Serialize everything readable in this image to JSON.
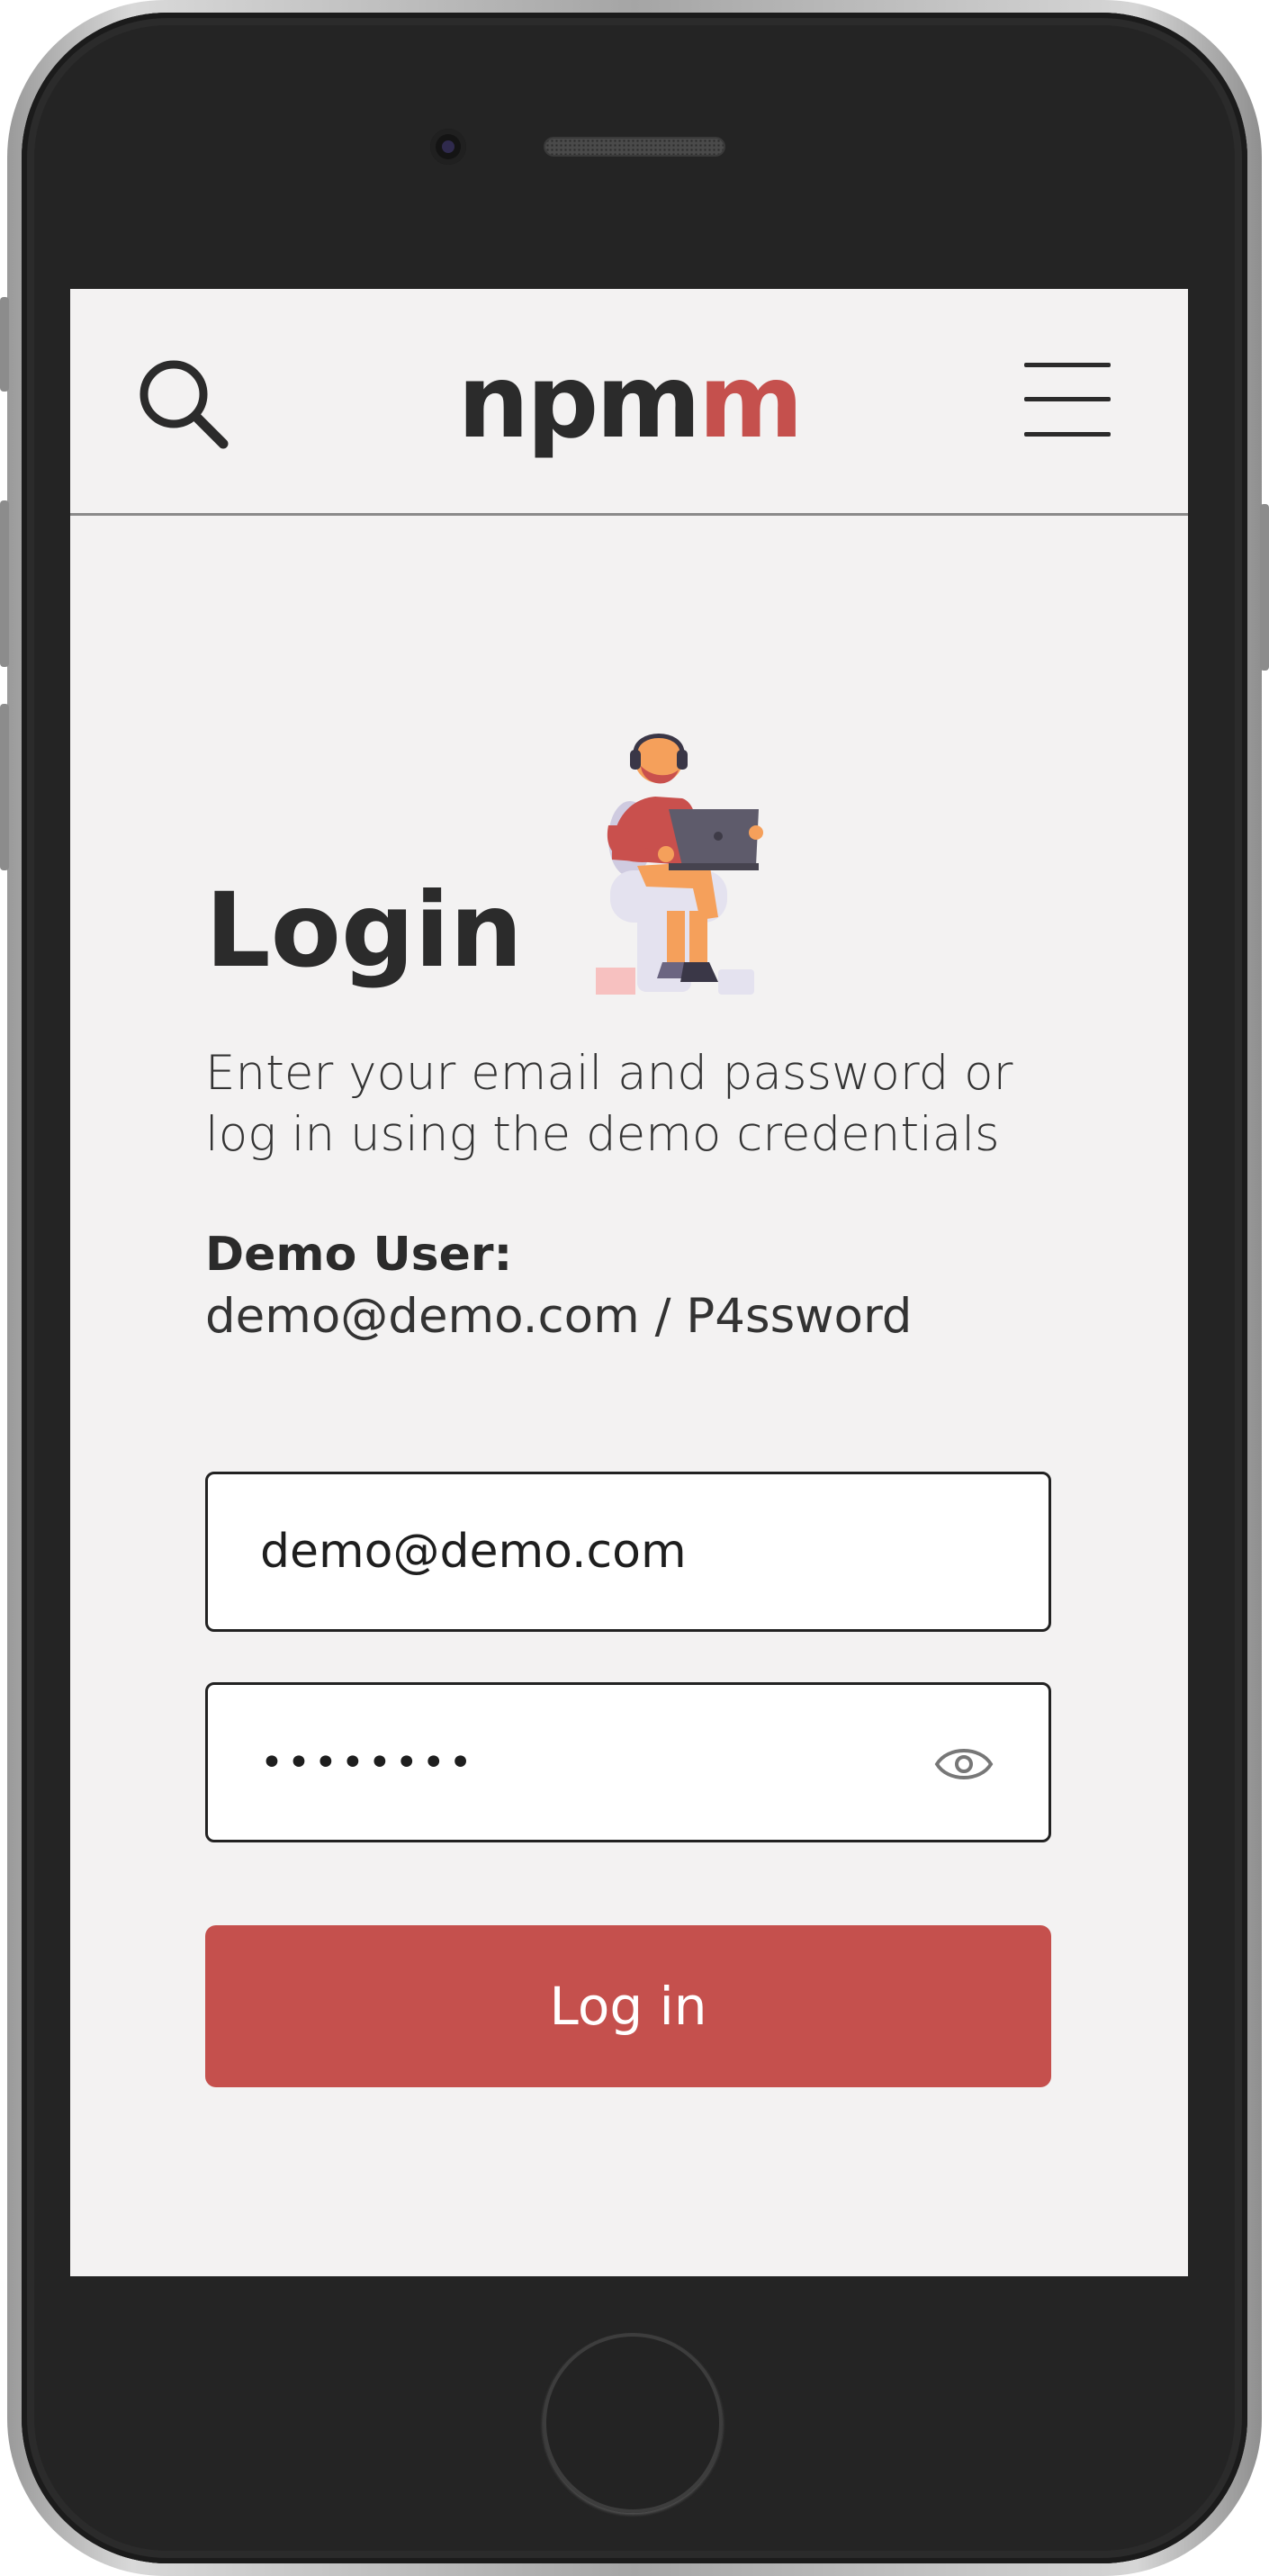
{
  "app": {
    "logo_main": "npm",
    "logo_accent": "m",
    "brand_color": "#c5504d"
  },
  "header": {
    "search_icon": "search-icon",
    "menu_icon": "hamburger-menu-icon"
  },
  "login": {
    "title": "Login",
    "subtitle": "Enter your email and password or log in using the demo credentials",
    "demo_label": "Demo User:",
    "demo_credentials": "demo@demo.com / P4ssword",
    "email_value": "demo@demo.com",
    "password_mask": "••••••••",
    "show_password_icon": "eye-icon",
    "submit_label": "Log in"
  }
}
